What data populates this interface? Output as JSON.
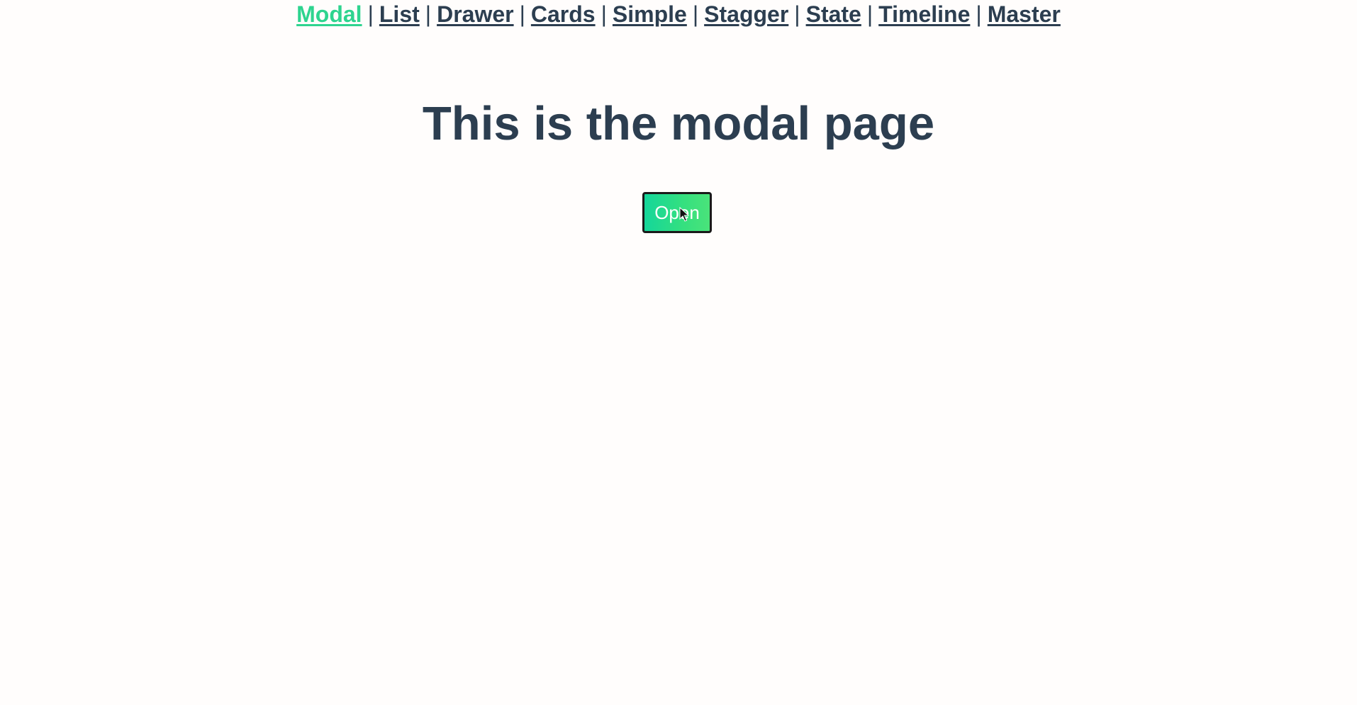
{
  "nav": {
    "items": [
      {
        "label": "Modal",
        "active": true
      },
      {
        "label": "List",
        "active": false
      },
      {
        "label": "Drawer",
        "active": false
      },
      {
        "label": "Cards",
        "active": false
      },
      {
        "label": "Simple",
        "active": false
      },
      {
        "label": "Stagger",
        "active": false
      },
      {
        "label": "State",
        "active": false
      },
      {
        "label": "Timeline",
        "active": false
      },
      {
        "label": "Master",
        "active": false
      }
    ],
    "separator": "|"
  },
  "main": {
    "title": "This is the modal page",
    "open_button_label": "Open"
  },
  "colors": {
    "text": "#2c3e50",
    "active_link": "#2ed48f",
    "background": "#fffdfc",
    "button_gradient_start": "#14d69a",
    "button_gradient_end": "#4ae37a"
  },
  "icons": {
    "cursor": "mouse-pointer-icon"
  }
}
